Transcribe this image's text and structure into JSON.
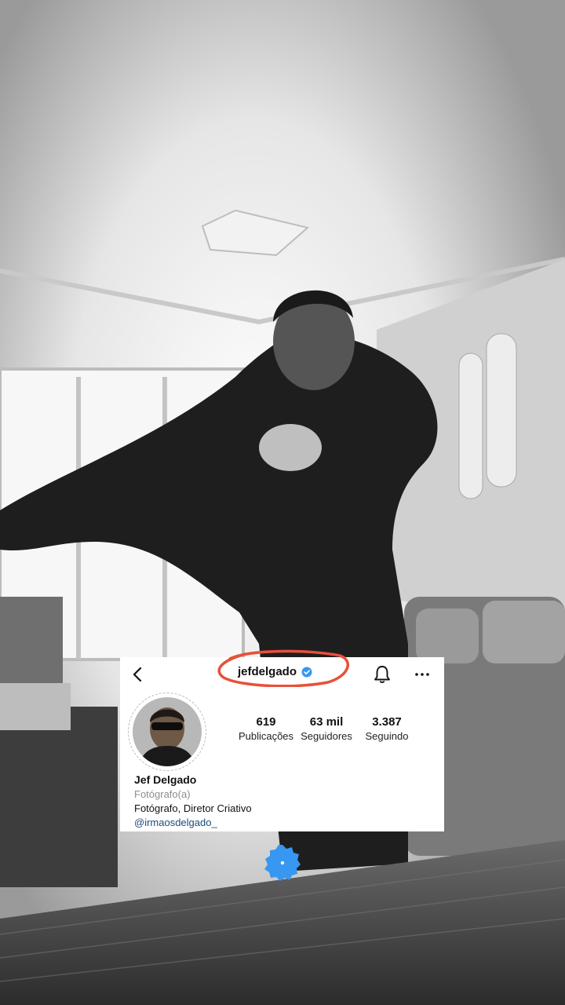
{
  "profile": {
    "username": "jefdelgado",
    "name": "Jef Delgado",
    "category": "Fotógrafo(a)",
    "bio": "Fotógrafo, Diretor Criativo",
    "link": "@irmaosdelgado_"
  },
  "stats": [
    {
      "value": "619",
      "label": "Publicações"
    },
    {
      "value": "63 mil",
      "label": "Seguidores"
    },
    {
      "value": "3.387",
      "label": "Seguindo"
    }
  ],
  "icons": {
    "back": "chevron-left-icon",
    "verified": "verified-badge-icon",
    "bell": "bell-icon",
    "more": "more-icon",
    "sticker": "verified-sticker-icon"
  },
  "colors": {
    "verified_blue": "#3897f0",
    "annotation_red": "#e8503a",
    "link_blue": "#1b4b7a"
  }
}
